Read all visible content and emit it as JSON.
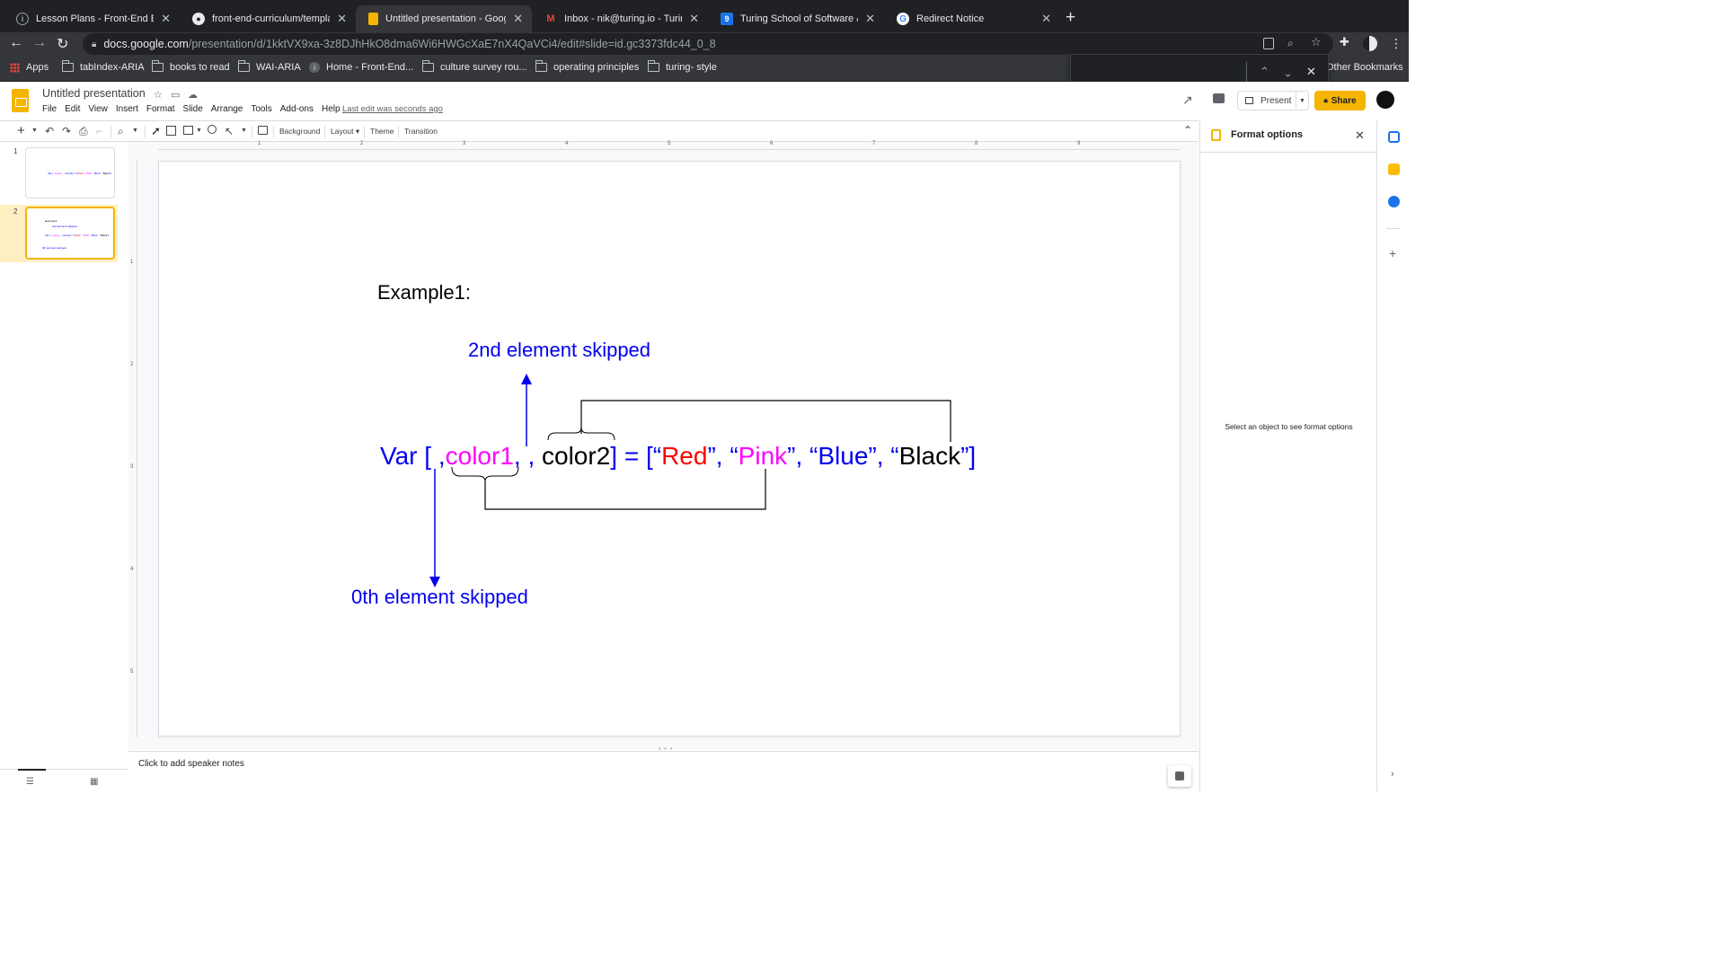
{
  "browser": {
    "tabs": [
      {
        "title": "Lesson Plans - Front-End Engi",
        "icon": "page-icon"
      },
      {
        "title": "front-end-curriculum/template",
        "icon": "github-icon"
      },
      {
        "title": "Untitled presentation - Google",
        "icon": "slides-icon",
        "active": true
      },
      {
        "title": "Inbox - nik@turing.io - Turing S",
        "icon": "gmail-icon"
      },
      {
        "title": "Turing School of Software & De",
        "icon": "turing-icon"
      },
      {
        "title": "Redirect Notice",
        "icon": "google-icon"
      }
    ],
    "url_host": "docs.google.com",
    "url_path": "/presentation/d/1kktVX9xa-3z8DJhHkO8dma6Wi6HWGcXaE7nX4QaVCi4/edit#slide=id.gc3373fdc44_0_8",
    "bookmarks": [
      {
        "label": "Apps",
        "icon": "apps-grid-icon"
      },
      {
        "label": "tabIndex-ARIA",
        "icon": "folder-icon"
      },
      {
        "label": "books to read",
        "icon": "folder-icon"
      },
      {
        "label": "WAI-ARIA",
        "icon": "folder-icon"
      },
      {
        "label": "Home - Front-End...",
        "icon": "page-icon"
      },
      {
        "label": "culture survey rou...",
        "icon": "folder-icon"
      },
      {
        "label": "operating principles",
        "icon": "folder-icon"
      },
      {
        "label": "turing- style",
        "icon": "folder-icon"
      }
    ],
    "other_bookmarks": "Other Bookmarks"
  },
  "docs": {
    "title": "Untitled presentation",
    "menu": [
      "File",
      "Edit",
      "View",
      "Insert",
      "Format",
      "Slide",
      "Arrange",
      "Tools",
      "Add-ons",
      "Help"
    ],
    "last_edit": "Last edit was seconds ago",
    "present_label": "Present",
    "share_label": "Share"
  },
  "toolbar": {
    "background": "Background",
    "layout": "Layout",
    "theme": "Theme",
    "transition": "Transition"
  },
  "filmstrip": {
    "slides": [
      {
        "number": "1"
      },
      {
        "number": "2",
        "selected": true
      }
    ]
  },
  "ruler": {
    "h_marks": [
      "1",
      "2",
      "3",
      "4",
      "5",
      "6",
      "7",
      "8",
      "9"
    ],
    "v_marks": [
      "1",
      "2",
      "3",
      "4",
      "5"
    ]
  },
  "slide": {
    "example_title": "Example1:",
    "label_top": "2nd element skipped",
    "label_bottom": "0th element skipped",
    "code_segments": [
      {
        "text": "Var [ ,",
        "color": "#0000ee"
      },
      {
        "text": "color1",
        "color": "#ff00ff"
      },
      {
        "text": ", , color2] = ",
        "color": "#000000",
        "split": [
          {
            "text": ", , ",
            "color": "#0000ee"
          },
          {
            "text": "color2",
            "color": "#000000"
          },
          {
            "text": "] = ",
            "color": "#0000ee"
          }
        ]
      },
      {
        "text": "[“",
        "color": "#0000ee"
      },
      {
        "text": "Red",
        "color": "#ff0000"
      },
      {
        "text": "”, “",
        "color": "#0000ee"
      },
      {
        "text": "Pink",
        "color": "#ff00ff"
      },
      {
        "text": "”, “",
        "color": "#0000ee"
      },
      {
        "text": "Blue",
        "color": "#0000ee"
      },
      {
        "text": "”, “",
        "color": "#0000ee"
      },
      {
        "text": "Black",
        "color": "#000000"
      },
      {
        "text": "”]",
        "color": "#0000ee"
      }
    ],
    "code_parts": {
      "p1": "Var [ ,",
      "p2": "color1",
      "p3": ",",
      "p4": " ,",
      "p5": "color2",
      "p6": "] = [“",
      "p7": "Red",
      "p8": "”, “",
      "p9": "Pink",
      "p10": "”, “",
      "p11": "Blue",
      "p12": "”, “",
      "p13": "Black",
      "p14": "”]"
    }
  },
  "notes": {
    "placeholder": "Click to add speaker notes"
  },
  "format_panel": {
    "title": "Format options",
    "empty_message": "Select an object to see format options"
  },
  "colors": {
    "accent": "#f4b400",
    "code_blue": "#0000ee",
    "code_magenta": "#ff00ff",
    "code_red": "#ff0000"
  }
}
